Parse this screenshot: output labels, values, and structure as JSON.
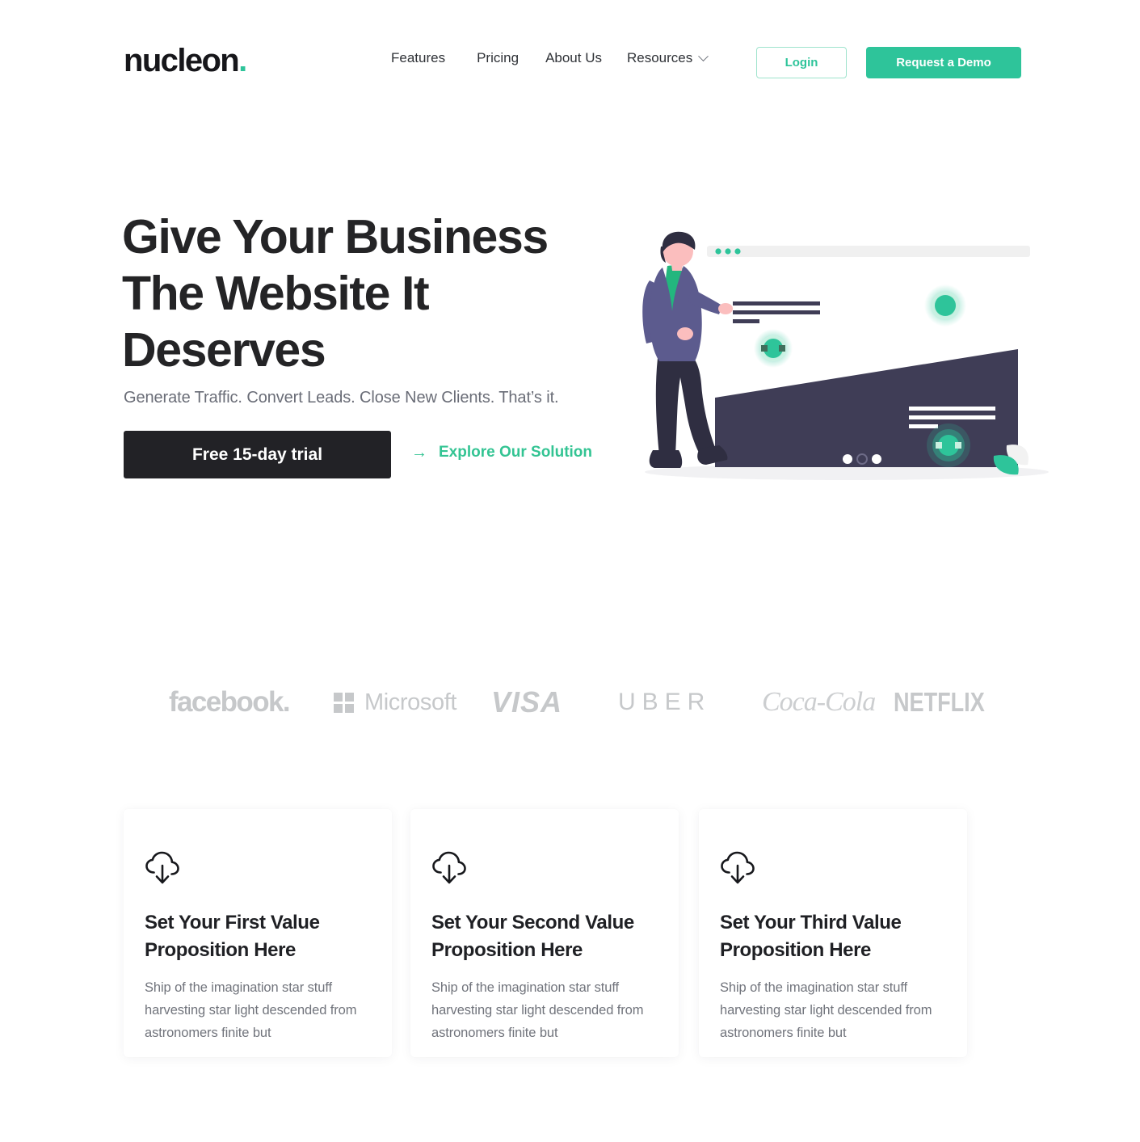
{
  "brand": {
    "name": "nucleon",
    "dot": ".",
    "accent_color": "#2ec49a",
    "dark_color": "#222226"
  },
  "nav": {
    "items": [
      {
        "label": "Features",
        "has_chevron": false,
        "icon": ""
      },
      {
        "label": "Pricing",
        "has_chevron": false,
        "icon": ""
      },
      {
        "label": "About Us",
        "has_chevron": false,
        "icon": ""
      },
      {
        "label": "Resources",
        "has_chevron": true,
        "icon": "chevron-down-icon"
      }
    ],
    "login_label": "Login",
    "demo_label": "Request a Demo"
  },
  "hero": {
    "title": "Give Your Business The Website It Deserves",
    "subtitle": "Generate Traffic. Convert Leads. Close New Clients. That’s it.",
    "primary_cta": "Free 15-day trial",
    "secondary_cta": "Explore Our Solution",
    "secondary_cta_icon": "arrow-right-icon",
    "illustration": {
      "name": "person-with-browser-window-illustration",
      "browser_dots": 3,
      "carousel_dots": 3,
      "carousel_active_index": 1,
      "colors": {
        "panel": "#3f3d56",
        "jacket": "#5c5b8e",
        "shirt": "#23b67e",
        "hair": "#2f2e41",
        "skin": "#fbbebe",
        "pants": "#2f2e41",
        "green": "#2ec49a",
        "bar": "#f0f0f0"
      }
    }
  },
  "logos": {
    "items": [
      {
        "label": "facebook",
        "icon": "facebook-wordmark"
      },
      {
        "label": "Microsoft",
        "icon": "microsoft-grid-icon"
      },
      {
        "label": "VISA",
        "icon": "visa-wordmark"
      },
      {
        "label": "UBER",
        "icon": "uber-wordmark"
      },
      {
        "label": "Coca-Cola",
        "icon": "coca-cola-wordmark"
      },
      {
        "label": "NETFLIX",
        "icon": "netflix-wordmark"
      }
    ],
    "color": "#c6c8ca"
  },
  "features": {
    "cards": [
      {
        "icon": "cloud-download-icon",
        "title": "Set Your First Value Proposition Here",
        "desc": "Ship of the imagination star stuff harvesting star light descended from astronomers finite but"
      },
      {
        "icon": "cloud-download-icon",
        "title": "Set Your Second Value Proposition Here",
        "desc": "Ship of the imagination star stuff harvesting star light descended from astronomers finite but"
      },
      {
        "icon": "cloud-download-icon",
        "title": "Set Your Third Value Proposition Here",
        "desc": "Ship of the imagination star stuff harvesting star light descended from astronomers finite but"
      }
    ]
  }
}
